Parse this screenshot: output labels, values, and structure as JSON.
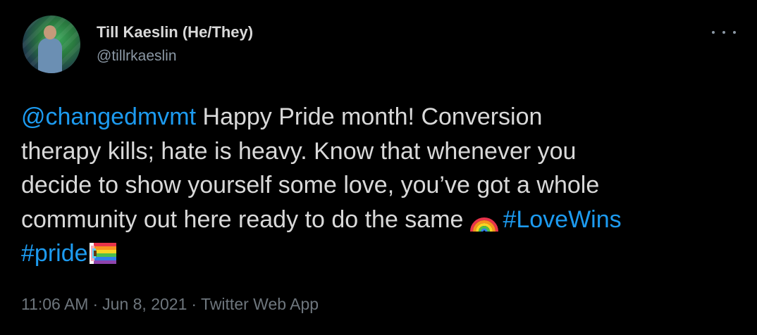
{
  "author": {
    "name": "Till Kaeslin (He/They)",
    "handle": "@tillrkaeslin"
  },
  "tweet": {
    "mention": "@changedmvmt",
    "line1_text": " Happy Pride month! Conversion",
    "line2": "therapy kills; hate is heavy. Know that whenever you",
    "line3": "decide to show yourself some love, you’ve got a whole",
    "line4_text": "community out here ready to do the same",
    "hashtag_lovewins": "#LoveWins",
    "hashtag_pride": "#pride"
  },
  "emojis": [
    "rainbow-icon",
    "progress-pride-flag-icon"
  ],
  "meta": {
    "time": "11:06 AM",
    "date": "Jun 8, 2021",
    "source": "Twitter Web App",
    "separator": "·"
  },
  "colors": {
    "background": "#000000",
    "text": "#d9d9d9",
    "secondary": "#8b98a5",
    "meta": "#6e767d",
    "link": "#1d9bf0"
  }
}
